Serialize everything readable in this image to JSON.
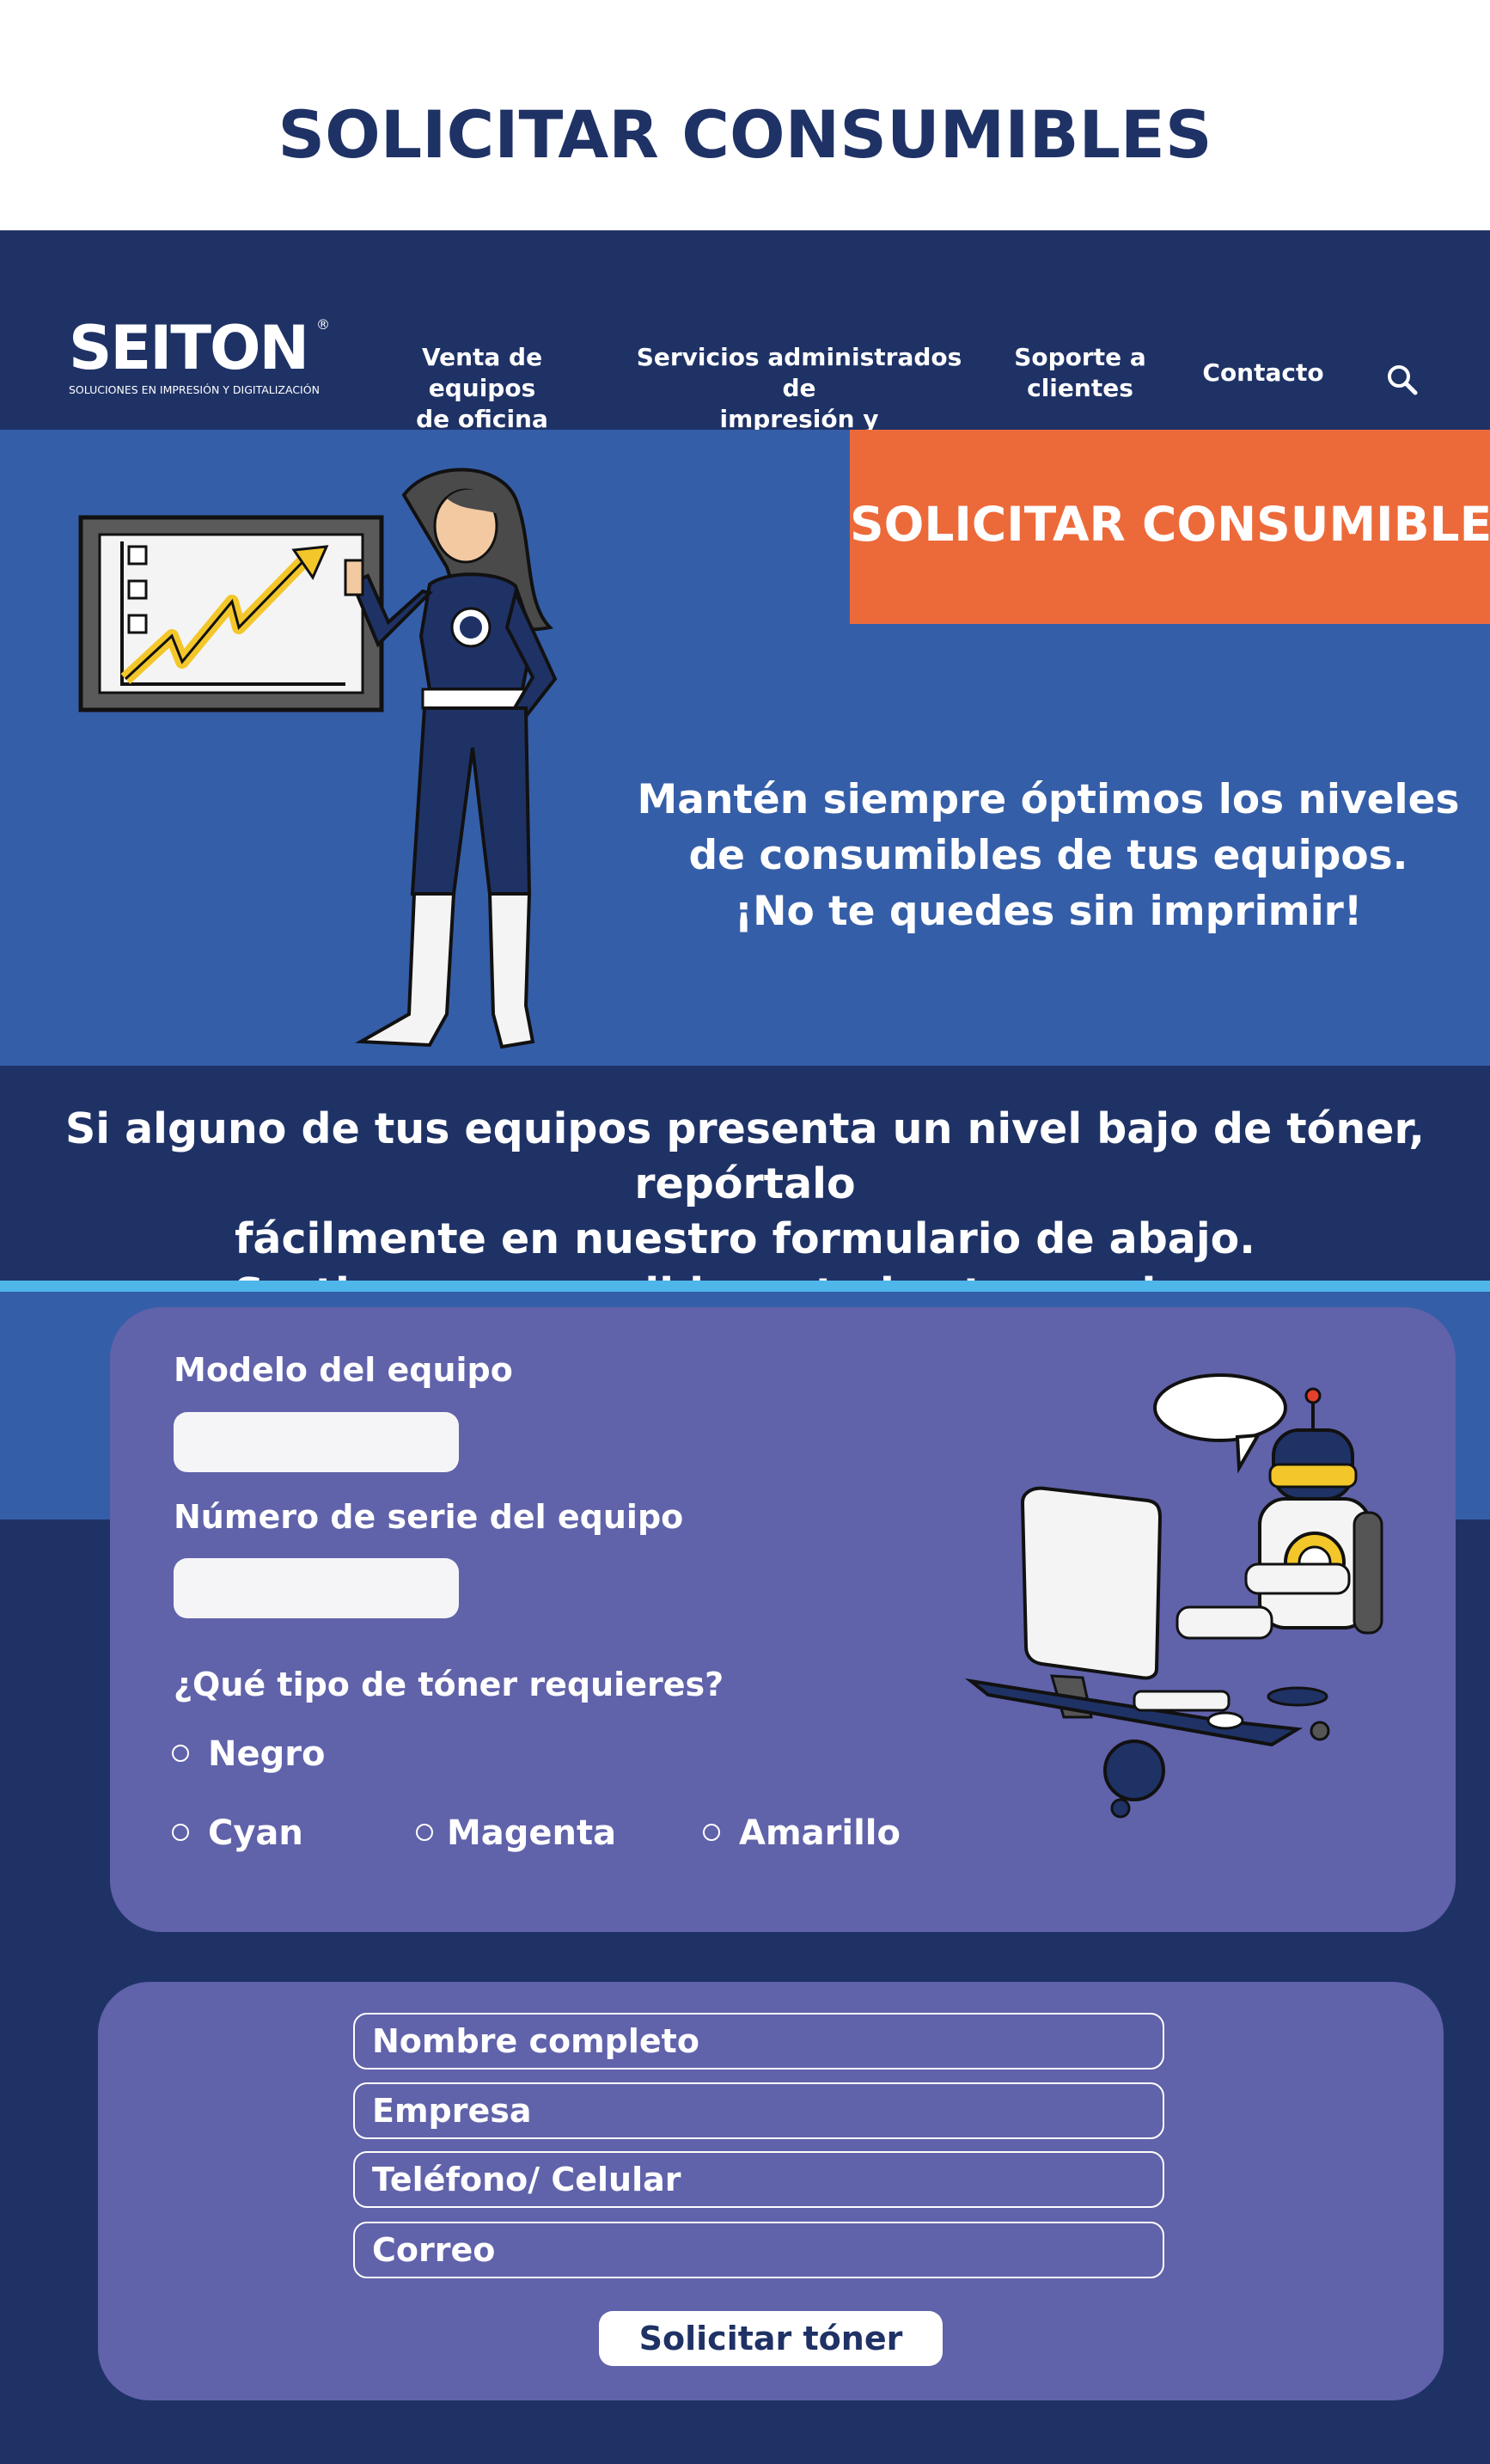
{
  "page": {
    "title": "SOLICITAR CONSUMIBLES"
  },
  "nav": {
    "logo_text": "SEITON",
    "logo_registered": "®",
    "logo_tagline": "SOLUCIONES EN IMPRESIÓN Y DIGITALIZACIÓN",
    "items": [
      {
        "label_line1": "Venta de equipos",
        "label_line2": "de oficina"
      },
      {
        "label_line1": "Servicios administrados de",
        "label_line2": "impresión y digitalización"
      },
      {
        "label_line1": "Soporte a",
        "label_line2": "clientes"
      },
      {
        "label_line1": "Contacto",
        "label_line2": ""
      }
    ],
    "search_icon": "search-icon"
  },
  "hero": {
    "badge": "SOLICITAR CONSUMIBLES",
    "tagline_line1": "Mantén siempre óptimos los niveles",
    "tagline_line2": "de consumibles de tus equipos.",
    "tagline_line3": "¡No te quedes sin imprimir!",
    "illustration_icon": "superhero-presenting-chart-icon"
  },
  "info": {
    "line1": "Si alguno de tus equipos presenta un nivel bajo de tóner, repórtalo",
    "line2": "fácilmente en nuestro formulario de abajo.",
    "line3": "Surtimos consumibles a todos tus equipos."
  },
  "equipment_form": {
    "model_label": "Modelo del equipo",
    "model_value": "",
    "serial_label": "Número de serie del equipo",
    "serial_value": "",
    "toner_question": "¿Qué tipo de tóner requieres?",
    "toner_options": [
      "Negro",
      "Cyan",
      "Magenta",
      "Amarillo"
    ],
    "selected_option": "",
    "illustration_icon": "robot-at-computer-icon"
  },
  "contact_form": {
    "fields": [
      "Nombre completo",
      "Empresa",
      "Teléfono/ Celular",
      "Correo"
    ],
    "submit_label": "Solicitar tóner"
  },
  "colors": {
    "navy": "#1f3266",
    "hero_blue": "#355ea8",
    "badge_orange": "#ec6a3a",
    "card_purple": "#6062aa",
    "accent_line": "#4fb6e9"
  }
}
